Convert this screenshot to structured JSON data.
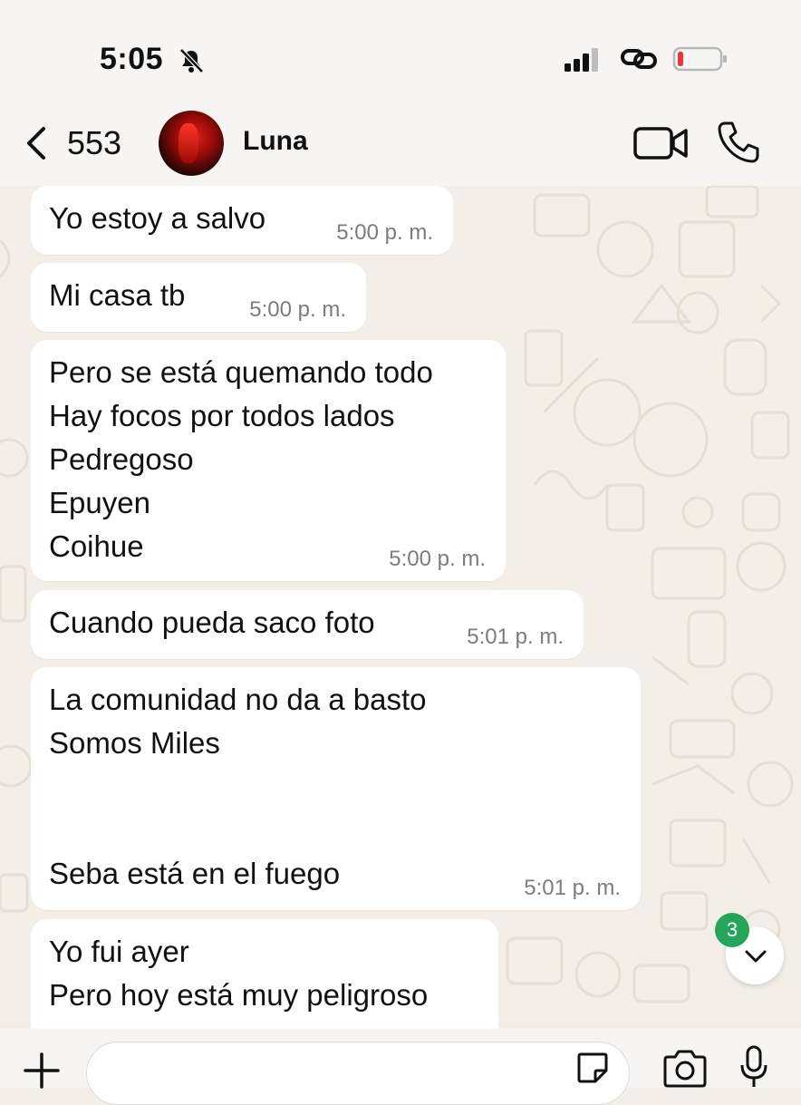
{
  "status_bar": {
    "time": "5:05",
    "icons": [
      "bell-slash-icon",
      "signal-icon",
      "link-icon",
      "battery-low-icon"
    ],
    "battery_color": "#e53935"
  },
  "header": {
    "back_count": "553",
    "contact_name": "Luna",
    "icons": [
      "chevron-left-icon",
      "video-camera-icon",
      "phone-icon"
    ]
  },
  "messages": [
    {
      "text": "Yo estoy a salvo",
      "time": "5:00 p. m."
    },
    {
      "text": "Mi casa tb",
      "time": "5:00 p. m."
    },
    {
      "text": "Pero se está quemando todo\nHay focos por todos lados\nPedregoso\nEpuyen\nCoihue",
      "time": "5:00 p. m."
    },
    {
      "text": "Cuando pueda saco foto",
      "time": "5:01 p. m."
    },
    {
      "text": "La comunidad no da a basto\nSomos Miles\n\n\nSeba está en el fuego",
      "time": "5:01 p. m."
    },
    {
      "text": "Yo fui ayer\nPero hoy está muy peligroso",
      "time": ""
    }
  ],
  "scroll_down": {
    "unread_count": "3",
    "icon": "chevron-down-icon"
  },
  "composer": {
    "placeholder": "",
    "icons": [
      "plus-icon",
      "sticker-icon",
      "camera-icon",
      "microphone-icon"
    ]
  },
  "colors": {
    "accent_green": "#25a55a",
    "bubble": "#ffffff",
    "wallpaper": "#f3efe8"
  }
}
